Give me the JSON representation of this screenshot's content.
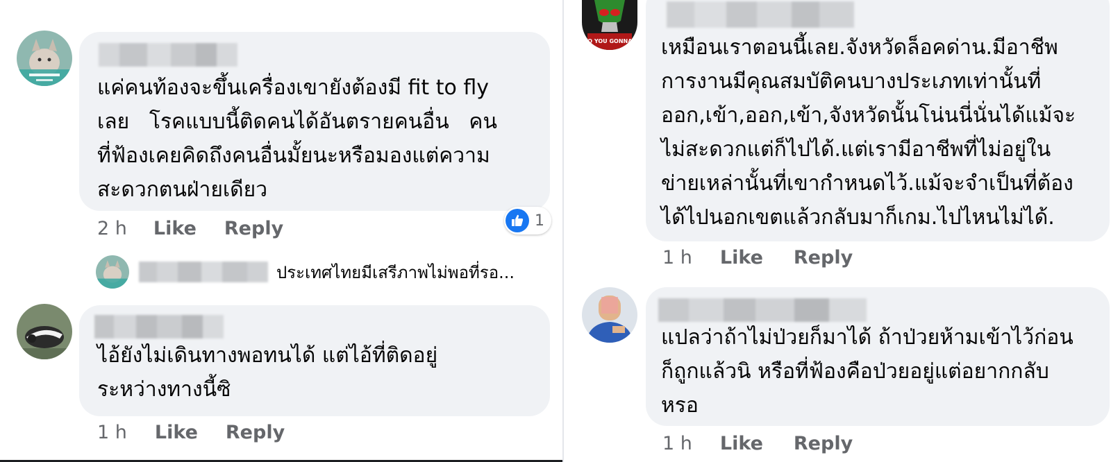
{
  "left_panel": {
    "comments": [
      {
        "lines": [
          "แค่คนท้องจะขึ้นเครื่องเขายังต้องมี fit to fly",
          "เลย   โรคแบบนี้ติดคนได้อันตรายคนอื่น   คน",
          "ที่ฟ้องเคยคิดถึงคนอื่นมั้ยนะหรือมองแต่ความ",
          "สะดวกตนฝ่ายเดียว"
        ],
        "time": "2 h",
        "like": "Like",
        "reply": "Reply",
        "reaction_count": "1"
      },
      {
        "lines": [
          "ไอ้ยังไม่เดินทางพอทนได้ แต่ไอ้ที่ติดอยู่",
          "ระหว่างทางนี้ซิ"
        ],
        "time": "1 h",
        "like": "Like",
        "reply": "Reply"
      }
    ],
    "reply_preview": {
      "text": "ประเทศไทยมีเสรีภาพไม่พอที่รอ..."
    }
  },
  "right_panel": {
    "comments": [
      {
        "lines": [
          "เหมือนเราตอนนี้เลย.จังหวัดล็อคด่าน.มีอาชีพ",
          "การงานมีคุณสมบัติคนบางประเภทเท่านั้นที่",
          "ออก,เข้า,ออก,เข้า,จังหวัดนั้นโน่นนี่นั่นได้แม้จะ",
          "ไม่สะดวกแต่ก็ไปได้.แต่เรามีอาชีพที่ไม่อยู่ใน",
          "ข่ายเหล่านั้นที่เขากำหนดไว้.แม้จะจำเป็นที่ต้อง",
          "ได้ไปนอกเขตแล้วกลับมาก็เกม.ไปไหนไม่ได้."
        ],
        "time": "1 h",
        "like": "Like",
        "reply": "Reply",
        "avatar_caption": "WHO YOU GONNA CA"
      },
      {
        "lines": [
          "แปลว่าถ้าไม่ป่วยก็มาได้ ถ้าป่วยห้ามเข้าไว้ก่อน",
          "ก็ถูกแล้วนิ หรือที่ฟ้องคือป่วยอยู่แต่อยากกลับ",
          "หรอ"
        ],
        "time": "1 h",
        "like": "Like",
        "reply": "Reply"
      }
    ]
  },
  "colors": {
    "bubble": "#f0f2f5",
    "action_text": "#65676b",
    "like_blue": "#1877f2",
    "text": "#050505"
  },
  "icons": {
    "reaction": "like-thumb-icon"
  }
}
